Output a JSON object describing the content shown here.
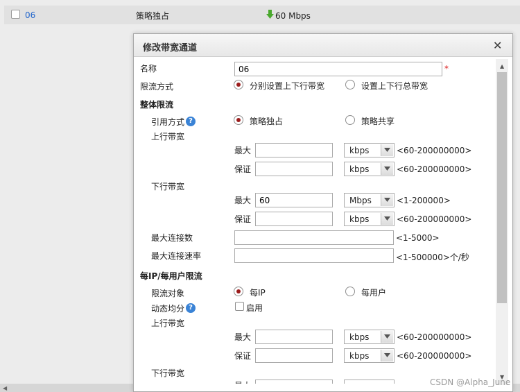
{
  "background": {
    "row": {
      "name": "06",
      "mode": "策略独占",
      "speed": "60 Mbps"
    }
  },
  "dialog": {
    "title": "修改带宽通道",
    "close_icon": "close-icon",
    "name_label": "名称",
    "name_value": "06",
    "required_mark": "*",
    "limit_mode_label": "限流方式",
    "limit_mode_options": [
      "分别设置上下行带宽",
      "设置上下行总带宽"
    ],
    "overall_section": "整体限流",
    "ref_mode_label": "引用方式",
    "ref_mode_options": [
      "策略独占",
      "策略共享"
    ],
    "up_bw_label": "上行带宽",
    "down_bw_label": "下行带宽",
    "max_label": "最大",
    "guarantee_label": "保证",
    "overall": {
      "up_max": {
        "value": "",
        "unit": "kbps",
        "range": "<60-200000000>"
      },
      "up_guarantee": {
        "value": "",
        "unit": "kbps",
        "range": "<60-200000000>"
      },
      "down_max": {
        "value": "60",
        "unit": "Mbps",
        "range": "<1-200000>"
      },
      "down_guarantee": {
        "value": "",
        "unit": "kbps",
        "range": "<60-200000000>"
      }
    },
    "max_conn_label": "最大连接数",
    "max_conn_range": "<1-5000>",
    "max_conn_rate_label": "最大连接速率",
    "max_conn_rate_range": "<1-500000>个/秒",
    "per_ip_section": "每IP/每用户限流",
    "limit_target_label": "限流对象",
    "limit_target_options": [
      "每IP",
      "每用户"
    ],
    "dynamic_label": "动态均分",
    "enable_label": "启用",
    "per_ip": {
      "up_max": {
        "value": "",
        "unit": "kbps",
        "range": "<60-200000000>"
      },
      "up_guarantee": {
        "value": "",
        "unit": "kbps",
        "range": "<60-200000000>"
      }
    },
    "partial_label": "最大"
  },
  "watermark": "CSDN @Alpha_June"
}
